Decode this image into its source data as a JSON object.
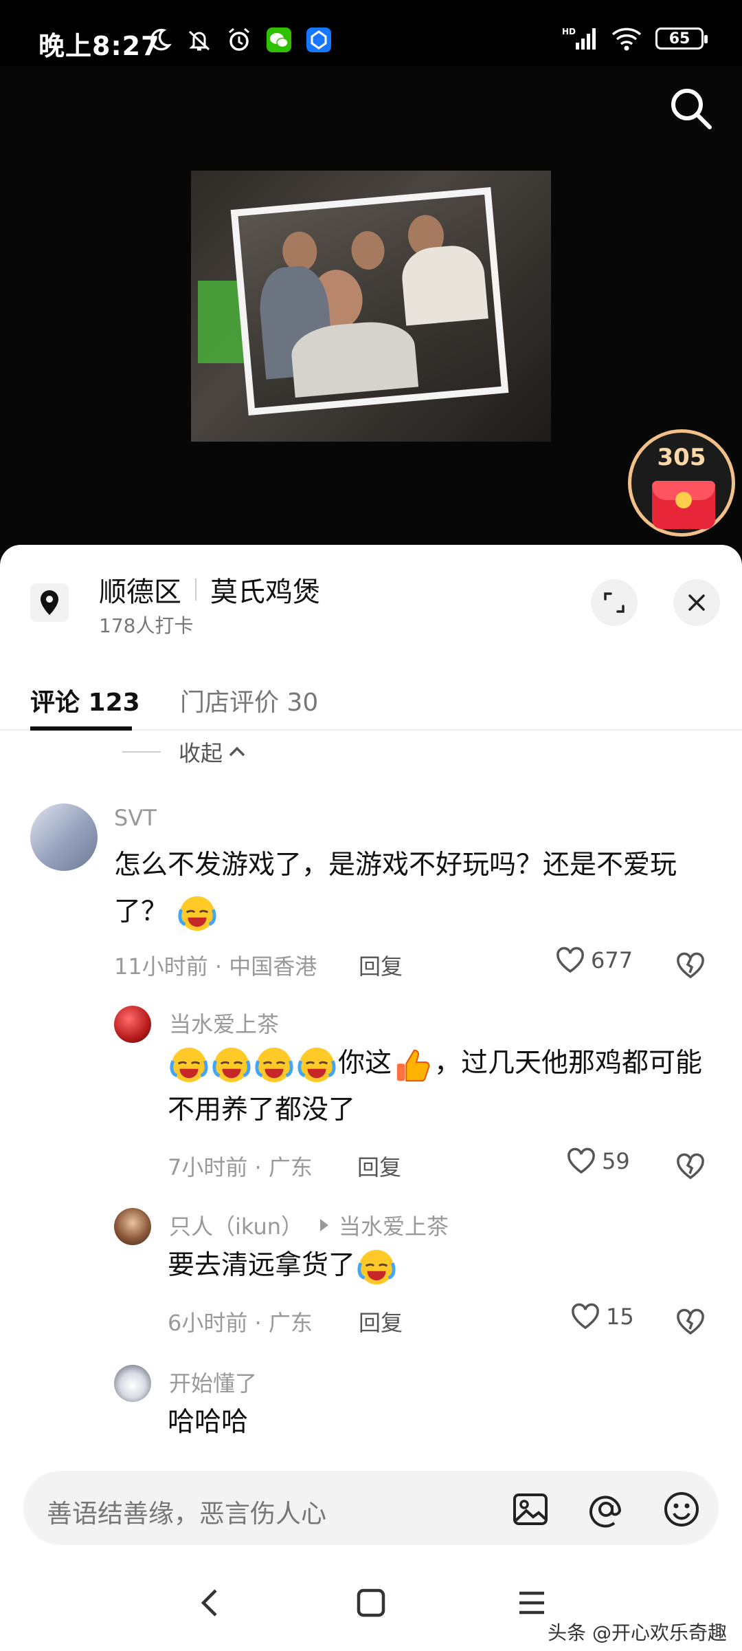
{
  "status_bar": {
    "time": "晚上8:27",
    "battery": "65",
    "icons_left": [
      "moon-icon",
      "bell-off-icon",
      "alarm-icon",
      "wechat-icon",
      "app-icon"
    ],
    "icons_right": [
      "hd-signal-icon",
      "wifi-icon",
      "battery-icon"
    ]
  },
  "video": {
    "redpack_count": "305"
  },
  "location": {
    "district": "顺德区",
    "place": "莫氏鸡煲",
    "checkins": "178人打卡"
  },
  "tabs": [
    {
      "label": "评论 123",
      "active": true
    },
    {
      "label": "门店评价 30",
      "active": false
    }
  ],
  "collapse_label": "收起",
  "comments": [
    {
      "user": "SVT",
      "text": "怎么不发游戏了，是游戏不好玩吗？还是不爱玩了？",
      "time_loc": "11小时前 · 中国香港",
      "reply": "回复",
      "likes": "677"
    },
    {
      "user": "当水爱上茶",
      "text_after_emojis": "你这",
      "text_rest": "，过几天他那鸡都可能不用养了都没了",
      "time_loc": "7小时前 · 广东",
      "reply": "回复",
      "likes": "59"
    },
    {
      "user": "只人（ikun）",
      "reply_to": "当水爱上茶",
      "text": "要去清远拿货了",
      "time_loc": "6小时前 · 广东",
      "reply": "回复",
      "likes": "15"
    },
    {
      "user": "开始懂了",
      "text": "哈哈哈"
    }
  ],
  "input": {
    "placeholder": "善语结善缘，恶言伤人心"
  },
  "watermark": "头条 @开心欢乐奇趣",
  "colors": {
    "accent_red": "#e8263a",
    "redpack_gold": "#f4c08a",
    "text_primary": "#111111",
    "text_secondary": "#999999"
  }
}
